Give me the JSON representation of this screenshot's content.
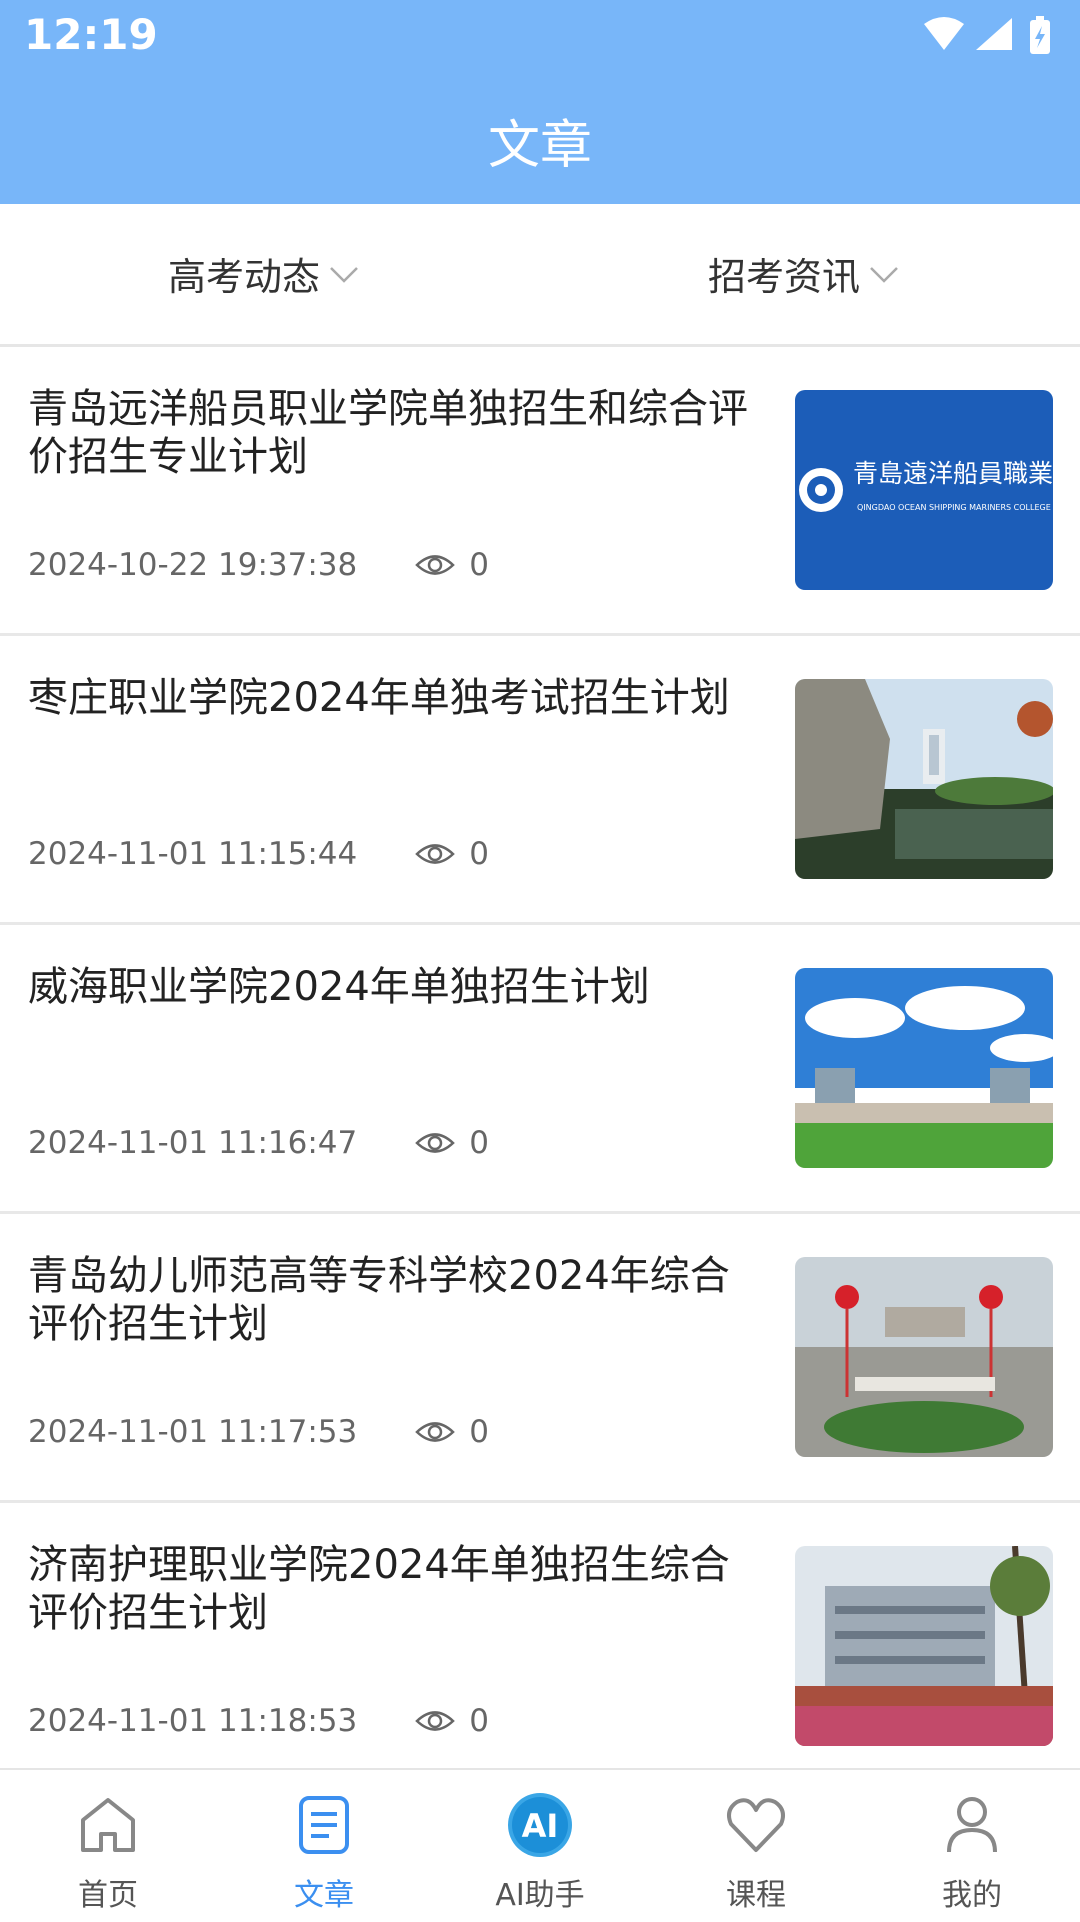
{
  "status": {
    "time": "12:19"
  },
  "header": {
    "title": "文章"
  },
  "filters": [
    {
      "label": "高考动态"
    },
    {
      "label": "招考资讯"
    }
  ],
  "articles": [
    {
      "title": "青岛远洋船员职业学院单独招生和综合评价招生专业计划",
      "date": "2024-10-22 19:37:38",
      "views": "0",
      "image": "qingdao-ocean-shipping-logo-banner",
      "logo_cn": "青島遠洋船員職業學院",
      "logo_en": "QINGDAO OCEAN SHIPPING MARINERS COLLEGE"
    },
    {
      "title": "枣庄职业学院2024年单独考试招生计划",
      "date": "2024-11-01 11:15:44",
      "views": "0",
      "image": "campus-cliff-pond-photo"
    },
    {
      "title": "威海职业学院2024年单独招生计划",
      "date": "2024-11-01 11:16:47",
      "views": "0",
      "image": "campus-blue-sky-lawn-photo"
    },
    {
      "title": "青岛幼儿师范高等专科学校2024年综合评价招生计划",
      "date": "2024-11-01 11:17:53",
      "views": "0",
      "image": "campus-gate-balloons-photo"
    },
    {
      "title": "济南护理职业学院2024年单独招生综合评价招生计划",
      "date": "2024-11-01 11:18:53",
      "views": "0",
      "image": "campus-building-trees-photo"
    }
  ],
  "tabbar": [
    {
      "label": "首页",
      "icon": "home-icon",
      "active": false
    },
    {
      "label": "文章",
      "icon": "article-icon",
      "active": true
    },
    {
      "label": "AI助手",
      "icon": "ai-assistant-icon",
      "active": false
    },
    {
      "label": "课程",
      "icon": "heart-icon",
      "active": false
    },
    {
      "label": "我的",
      "icon": "user-icon",
      "active": false
    }
  ],
  "colors": {
    "header": "#78b6f9",
    "accent": "#3b8ff0",
    "logo_bg": "#1c5db8"
  }
}
